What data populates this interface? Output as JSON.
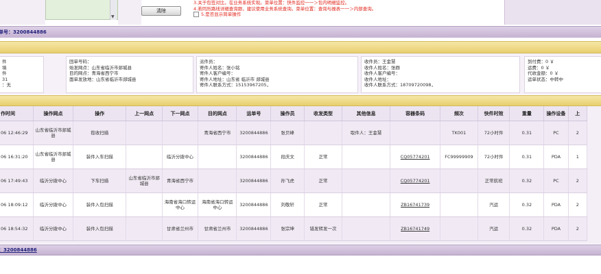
{
  "top": {
    "reset_button": "清除",
    "notice_lines": [
      "3.关于包签对比，在业务系统实现。菜单位置：快件监控一一＞包内明细监控。",
      "4.若同历路线详细查询跟，建议使用业务系统查询。菜单位置：查询与报表一一＞内部查询。"
    ],
    "checkbox_label": "5.是否显示简单操作"
  },
  "waybill_bar": "单号：3200844886",
  "info": {
    "col1": [
      "件",
      "填",
      "件",
      "31",
      "：无"
    ],
    "col2": [
      "回单号码：",
      "始发网点：山东省临沂市郯城县",
      "目的网点：青海省西宁市",
      "面单发放地：山东省临沂市郯城县"
    ],
    "col3": [
      "派件员：",
      "寄件人姓名：张小铭",
      "寄件人客户编号：",
      "寄件人地址：山东省 临沂市 郯城县",
      "寄件人联系方式：15153967205，"
    ],
    "col4": [
      "收件员：王金慧",
      "收件人姓名：张群",
      "收件人客户编号：",
      "收件人地址：",
      "收件人联系方式：18709720098，"
    ],
    "col5": [
      "到付费：0 ￥",
      "运费：0 ￥",
      "代收金额：0 ￥",
      "运单状态：中转中"
    ]
  },
  "table": {
    "headers": [
      "作时间",
      "操作网点",
      "操作",
      "上一网点",
      "下一网点",
      "目的网点",
      "运单号",
      "操作员",
      "收发类型",
      "其他信息",
      "容器条码",
      "频次",
      "快件时效",
      "重量",
      "操作设备",
      "上"
    ],
    "rows": [
      [
        "06 12:46:29",
        "山东省临沂市郯城县",
        "揽收扫描",
        "",
        "",
        "青海省西宁市",
        "3200844886",
        "张贝峰",
        "",
        "取件人：王金慧",
        "",
        "TK001",
        "72小时件",
        "0.31",
        "PC",
        "2"
      ],
      [
        "06 16:31:20",
        "山东省临沂市郯城县",
        "装件入车扫描",
        "",
        "临沂分拨中心",
        "",
        "3200844886",
        "段庆文",
        "正常",
        "",
        "CQ05774201",
        "FC99999909",
        "72小时件",
        "0.31",
        "PDA",
        "1"
      ],
      [
        "06 17:49:43",
        "临沂分拨中心",
        "下车扫描",
        "山东省临沂市郯城县",
        "青海省西宁市",
        "",
        "3200844886",
        "孙飞虎",
        "正常",
        "",
        "CQ05774201",
        "",
        "正常航班",
        "0.32",
        "PC",
        "2"
      ],
      [
        "06 18:09:12",
        "临沂分拨中心",
        "装件入包扫描",
        "",
        "海南省海口转运中心",
        "海南省海口转运中心",
        "3200844886",
        "刘敬轩",
        "正常",
        "",
        "ZB16741739",
        "",
        "汽运",
        "0.32",
        "PDA",
        "2"
      ],
      [
        "06 18:54:32",
        "临沂分拨中心",
        "装件入包扫描",
        "",
        "甘肃省兰州市",
        "甘肃省兰州市",
        "3200844886",
        "张宗坤",
        "错发转发一次",
        "",
        "ZB16741749",
        "",
        "汽运",
        "0.32",
        "PDA",
        "2"
      ]
    ]
  },
  "footer_bar": "：3200844886"
}
